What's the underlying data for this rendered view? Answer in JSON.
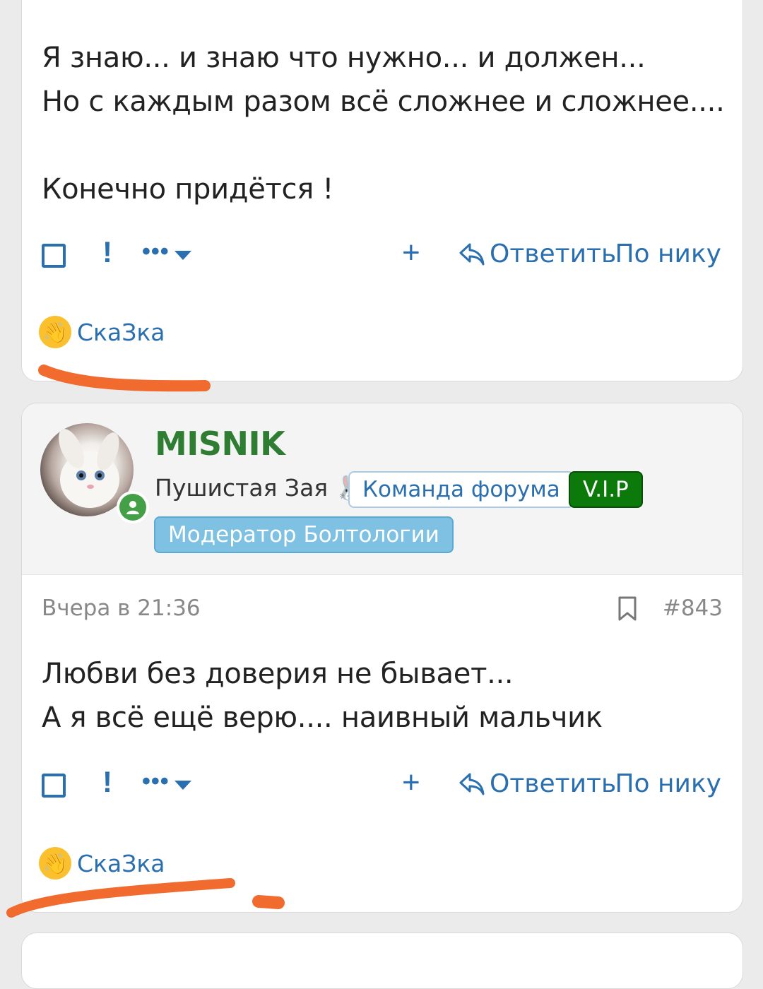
{
  "post1": {
    "text": "Я знаю... и знаю что нужно... и должен...\nНо с каждым разом всё сложнее и сложнее....\n\nКонечно придётся !",
    "actions": {
      "more": "•••",
      "plus": "+",
      "reply": "Ответить",
      "by_nick": "По нику"
    },
    "reaction": {
      "emoji": "👋",
      "user": "СкаЗка"
    }
  },
  "post2": {
    "username": "MISNIK",
    "user_title": "Пушистая Зая 🐰",
    "badges": {
      "team": "Команда форума",
      "vip": "V.I.P",
      "moderator": "Модератор Болтологии"
    },
    "time": "Вчера в 21:36",
    "number": "#843",
    "text": "Любви без доверия не бывает...\nА я всё ещё верю.... наивный мальчик",
    "actions": {
      "more": "•••",
      "plus": "+",
      "reply": "Ответить",
      "by_nick": "По нику"
    },
    "reaction": {
      "emoji": "👋",
      "user": "СкаЗка"
    }
  },
  "colors": {
    "accent": "#2a6fb0",
    "username": "#2e7d32",
    "vip": "#0b7a0b",
    "moderator": "#7fc1e2",
    "scribble": "#f26b2e"
  }
}
